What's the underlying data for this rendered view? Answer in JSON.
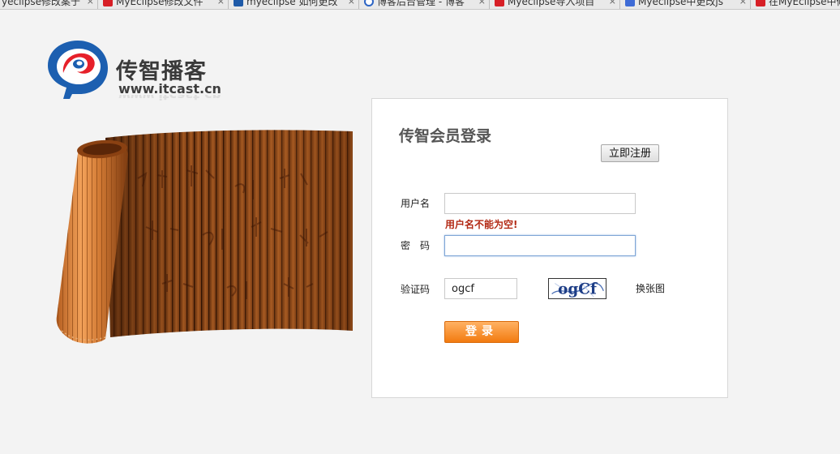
{
  "browser": {
    "tabs": [
      {
        "title": "yeclipse修改案于",
        "favicon": "none"
      },
      {
        "title": "MyEclipse修改文件",
        "favicon": "red-c-icon"
      },
      {
        "title": "myeclipse 如何更改",
        "favicon": "blue-c-icon"
      },
      {
        "title": "博客后台管理 - 博客",
        "favicon": "ring-icon"
      },
      {
        "title": "Myeclipse导入项目",
        "favicon": "red-c-icon"
      },
      {
        "title": "Myeclipse中更改js",
        "favicon": "blue-paw-icon"
      },
      {
        "title": "在MyEclipse中修",
        "favicon": "red-c-icon"
      }
    ],
    "close_glyph": "×"
  },
  "brand": {
    "name": "传智播客",
    "url": "www.itcast.cn",
    "logo_colors": {
      "blue": "#1c5fb0",
      "red": "#e6202a"
    }
  },
  "login": {
    "title": "传智会员登录",
    "register_label": "立即注册",
    "username_label": "用户名",
    "username_value": "",
    "username_error": "用户名不能为空!",
    "password_label": "密　码",
    "password_value": "",
    "captcha_label": "验证码",
    "captcha_value": "ogcf",
    "captcha_image_text": "ogCf",
    "refresh_label": "换张图",
    "submit_label": "登录"
  },
  "colors": {
    "error": "#b32a15",
    "login_button": "#f27b10",
    "background": "#f3f3f3"
  }
}
